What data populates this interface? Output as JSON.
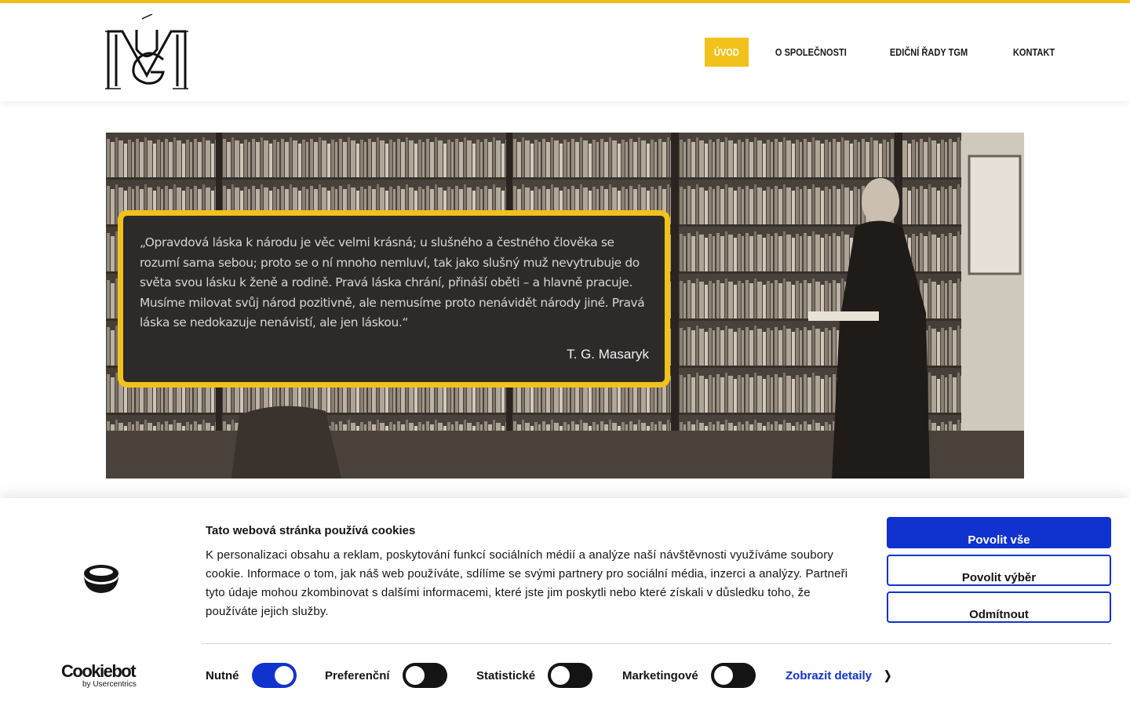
{
  "header": {
    "logo_alt": "ÚMG monogram",
    "nav": [
      {
        "label": "ÚVOD",
        "active": true
      },
      {
        "label": "O SPOLEČNOSTI",
        "active": false
      },
      {
        "label": "EDIČNÍ ŘADY TGM",
        "active": false
      },
      {
        "label": "KONTAKT",
        "active": false
      }
    ]
  },
  "hero": {
    "quote": "„Opravdová láska k národu je věc velmi krásná; u slušného a čestného člověka se rozumí sama sebou; proto se o ní mnoho nemluví, tak jako slušný muž nevytrubuje do světa svou lásku k ženě a rodině. Pravá láska chrání, přináší oběti – a hlavně pracuje. Musíme milovat svůj národ pozitivně, ale nemusíme proto nenávidět národy jiné. Pravá láska se nedokazuje nenávistí, ale jen láskou.“",
    "author": "T. G. Masaryk"
  },
  "cookie_banner": {
    "title": "Tato webová stránka používá cookies",
    "text": "K personalizaci obsahu a reklam, poskytování funkcí sociálních médií a analýze naší návštěvnosti využíváme soubory cookie. Informace o tom, jak náš web používáte, sdílíme se svými partnery pro sociální média, inzerci a analýzy. Partneři tyto údaje mohou zkombinovat s dalšími informacemi, které jste jim poskytli nebo které získali v důsledku toho, že používáte jejich služby.",
    "buttons": {
      "allow_all": "Povolit vše",
      "allow_selection": "Povolit výběr",
      "deny": "Odmítnout"
    },
    "toggles": [
      {
        "label": "Nutné",
        "on": true
      },
      {
        "label": "Preferenční",
        "on": false
      },
      {
        "label": "Statistické",
        "on": false
      },
      {
        "label": "Marketingové",
        "on": false
      }
    ],
    "details_link": "Zobrazit detaily",
    "brand": {
      "name": "Cookiebot",
      "byline": "by Usercentrics"
    }
  },
  "colors": {
    "accent": "#f2c21b",
    "cookie_blue": "#1032cf",
    "quote_bg": "#2d2a2a"
  }
}
